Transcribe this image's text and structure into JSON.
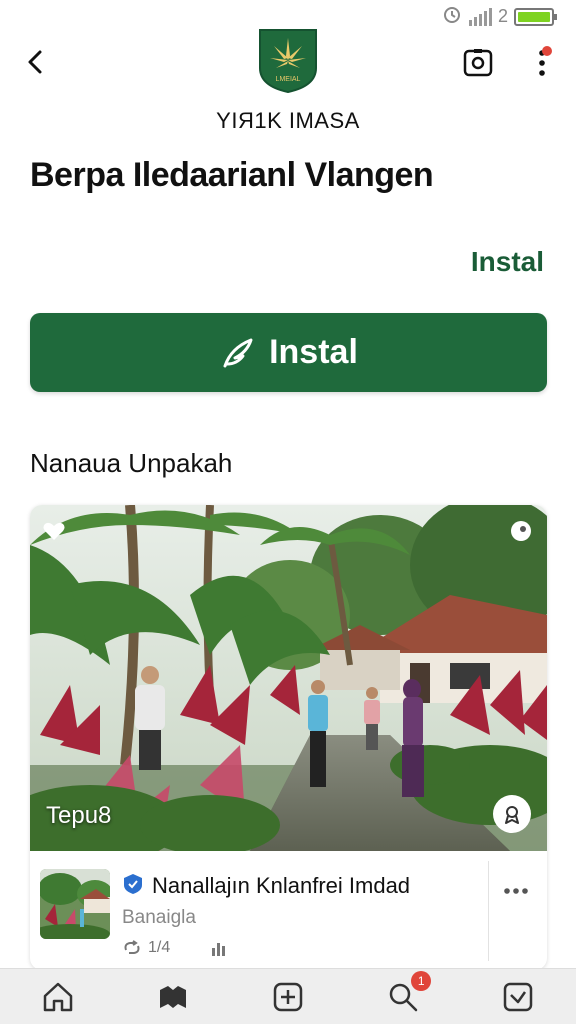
{
  "status_bar": {
    "network_label": "2"
  },
  "header": {
    "brand_name": "YIЯ1K IMASA",
    "logo_text": "LMEIAL",
    "brand_color": "#1f6a3c"
  },
  "page": {
    "title": "Berpa Iledaarianl Vlangen",
    "install_link": "Instal",
    "install_button": "Instal",
    "section_title": "Nanaua Unpakah"
  },
  "card": {
    "image_caption": "Tepu8",
    "title": "Nanallajın Knlanfrei Imdad",
    "subtitle": "Banaigla",
    "stats": {
      "reposts": "1/4"
    }
  },
  "nav": {
    "items": [
      {
        "icon": "home-icon"
      },
      {
        "icon": "library-icon"
      },
      {
        "icon": "add-icon"
      },
      {
        "icon": "search-icon",
        "badge": "1"
      },
      {
        "icon": "check-icon"
      }
    ]
  },
  "colors": {
    "accent": "#1f6a3c",
    "badge": "#e0453a",
    "battery": "#7ed321"
  }
}
